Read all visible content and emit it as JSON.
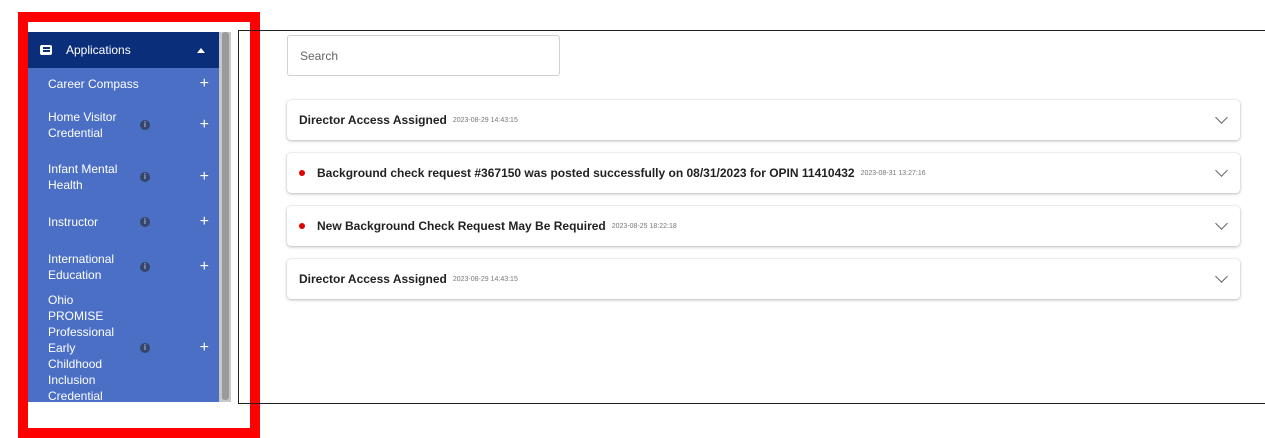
{
  "sidebar": {
    "header_label": "Applications",
    "items": [
      {
        "label": "Career Compass",
        "has_info": false
      },
      {
        "label": "Home Visitor Credential",
        "has_info": true
      },
      {
        "label": "Infant Mental Health",
        "has_info": true
      },
      {
        "label": "Instructor",
        "has_info": true
      },
      {
        "label": "International Education",
        "has_info": true
      },
      {
        "label": "Ohio PROMISE Professional Early Childhood Inclusion Credential",
        "has_info": true
      }
    ],
    "info_glyph": "i",
    "plus_glyph": "+"
  },
  "search": {
    "placeholder": "Search"
  },
  "notifications": [
    {
      "title": "Director Access Assigned",
      "timestamp": "2023-08-29 14:43:15",
      "unread": false
    },
    {
      "title": "Background check request #367150 was posted successfully on 08/31/2023 for OPIN 11410432",
      "timestamp": "2023-08-31 13:27:16",
      "unread": true
    },
    {
      "title": "New Background Check Request May Be Required",
      "timestamp": "2023-08-25 18:22:18",
      "unread": true
    },
    {
      "title": "Director Access Assigned",
      "timestamp": "2023-08-29 14:43:15",
      "unread": false
    }
  ],
  "colors": {
    "sidebar_bg": "#4a6fc4",
    "sidebar_header_bg": "#0b2e7a",
    "highlight_border": "#ff0000",
    "unread_dot": "#e00000"
  }
}
